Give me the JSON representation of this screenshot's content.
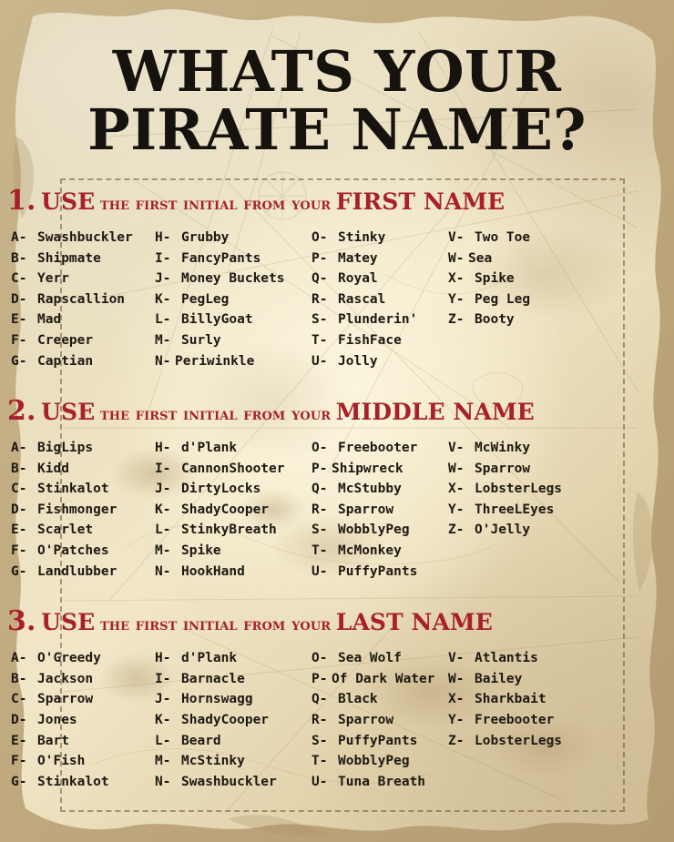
{
  "poster": {
    "title_line1": "WHATS YOUR",
    "title_line2": "PIRATE NAME?",
    "colors": {
      "ink": "#1d1913",
      "heading_red": "#a8202b",
      "parchment": "#e8dcbb"
    }
  },
  "sections": [
    {
      "number": "1.",
      "head_use": "USE",
      "head_mid": "the first initial from your",
      "head_tail": "FIRST NAME",
      "columns": [
        [
          {
            "key": "A-",
            "value": "Swashbuckler"
          },
          {
            "key": "B-",
            "value": "Shipmate"
          },
          {
            "key": "C-",
            "value": "Yerr"
          },
          {
            "key": "D-",
            "value": "Rapscallion"
          },
          {
            "key": "E-",
            "value": "Mad"
          },
          {
            "key": "F-",
            "value": "Creeper"
          },
          {
            "key": "G-",
            "value": "Captian"
          }
        ],
        [
          {
            "key": "H-",
            "value": "Grubby"
          },
          {
            "key": "I-",
            "value": "FancyPants"
          },
          {
            "key": "J-",
            "value": "Money Buckets"
          },
          {
            "key": "K-",
            "value": "PegLeg"
          },
          {
            "key": "L-",
            "value": "BillyGoat"
          },
          {
            "key": "M-",
            "value": "Surly"
          },
          {
            "key": "N-",
            "value": "Periwinkle"
          }
        ],
        [
          {
            "key": "O-",
            "value": "Stinky"
          },
          {
            "key": "P-",
            "value": "Matey"
          },
          {
            "key": "Q-",
            "value": "Royal"
          },
          {
            "key": "R-",
            "value": "Rascal"
          },
          {
            "key": "S-",
            "value": "Plunderin'"
          },
          {
            "key": "T-",
            "value": "FishFace"
          },
          {
            "key": "U-",
            "value": "Jolly"
          }
        ],
        [
          {
            "key": "V-",
            "value": "Two Toe"
          },
          {
            "key": "W-",
            "value": "Sea"
          },
          {
            "key": "X-",
            "value": "Spike"
          },
          {
            "key": "Y-",
            "value": "Peg Leg"
          },
          {
            "key": "Z-",
            "value": "Booty"
          }
        ]
      ]
    },
    {
      "number": "2.",
      "head_use": "USE",
      "head_mid": "the first initial from your",
      "head_tail": "MIDDLE NAME",
      "columns": [
        [
          {
            "key": "A-",
            "value": "BigLips"
          },
          {
            "key": "B-",
            "value": "Kidd"
          },
          {
            "key": "C-",
            "value": "Stinkalot"
          },
          {
            "key": "D-",
            "value": "Fishmonger"
          },
          {
            "key": "E-",
            "value": "Scarlet"
          },
          {
            "key": "F-",
            "value": "O'Patches"
          },
          {
            "key": "G-",
            "value": "Landlubber"
          }
        ],
        [
          {
            "key": "H-",
            "value": "d'Plank"
          },
          {
            "key": "I-",
            "value": "CannonShooter"
          },
          {
            "key": "J-",
            "value": "DirtyLocks"
          },
          {
            "key": "K-",
            "value": "ShadyCooper"
          },
          {
            "key": "L-",
            "value": "StinkyBreath"
          },
          {
            "key": "M-",
            "value": "Spike"
          },
          {
            "key": "N-",
            "value": "HookHand"
          }
        ],
        [
          {
            "key": "O-",
            "value": "Freebooter"
          },
          {
            "key": "P-",
            "value": "Shipwreck"
          },
          {
            "key": "Q-",
            "value": "McStubby"
          },
          {
            "key": "R-",
            "value": "Sparrow"
          },
          {
            "key": "S-",
            "value": "WobblyPeg"
          },
          {
            "key": "T-",
            "value": "McMonkey"
          },
          {
            "key": "U-",
            "value": "PuffyPants"
          }
        ],
        [
          {
            "key": "V-",
            "value": "McWinky"
          },
          {
            "key": "W-",
            "value": "Sparrow"
          },
          {
            "key": "X-",
            "value": "LobsterLegs"
          },
          {
            "key": "Y-",
            "value": "ThreeLEyes"
          },
          {
            "key": "Z-",
            "value": "O'Jelly"
          }
        ]
      ]
    },
    {
      "number": "3.",
      "head_use": "USE",
      "head_mid": "the first initial from your",
      "head_tail": "LAST NAME",
      "columns": [
        [
          {
            "key": "A-",
            "value": "O'Greedy"
          },
          {
            "key": "B-",
            "value": "Jackson"
          },
          {
            "key": "C-",
            "value": "Sparrow"
          },
          {
            "key": "D-",
            "value": "Jones"
          },
          {
            "key": "E-",
            "value": "Bart"
          },
          {
            "key": "F-",
            "value": "O'Fish"
          },
          {
            "key": "G-",
            "value": "Stinkalot"
          }
        ],
        [
          {
            "key": "H-",
            "value": "d'Plank"
          },
          {
            "key": "I-",
            "value": "Barnacle"
          },
          {
            "key": "J-",
            "value": "Hornswagg"
          },
          {
            "key": "K-",
            "value": "ShadyCooper"
          },
          {
            "key": "L-",
            "value": "Beard"
          },
          {
            "key": "M-",
            "value": "McStinky"
          },
          {
            "key": "N-",
            "value": "Swashbuckler"
          }
        ],
        [
          {
            "key": "O-",
            "value": "Sea Wolf"
          },
          {
            "key": "P-",
            "value": "Of Dark Water"
          },
          {
            "key": "Q-",
            "value": "Black"
          },
          {
            "key": "R-",
            "value": "Sparrow"
          },
          {
            "key": "S-",
            "value": "PuffyPants"
          },
          {
            "key": "T-",
            "value": "WobblyPeg"
          },
          {
            "key": "U-",
            "value": "Tuna Breath"
          }
        ],
        [
          {
            "key": "V-",
            "value": "Atlantis"
          },
          {
            "key": "W-",
            "value": "Bailey"
          },
          {
            "key": "X-",
            "value": "Sharkbait"
          },
          {
            "key": "Y-",
            "value": "Freebooter"
          },
          {
            "key": "Z-",
            "value": "LobsterLegs"
          }
        ]
      ]
    }
  ]
}
